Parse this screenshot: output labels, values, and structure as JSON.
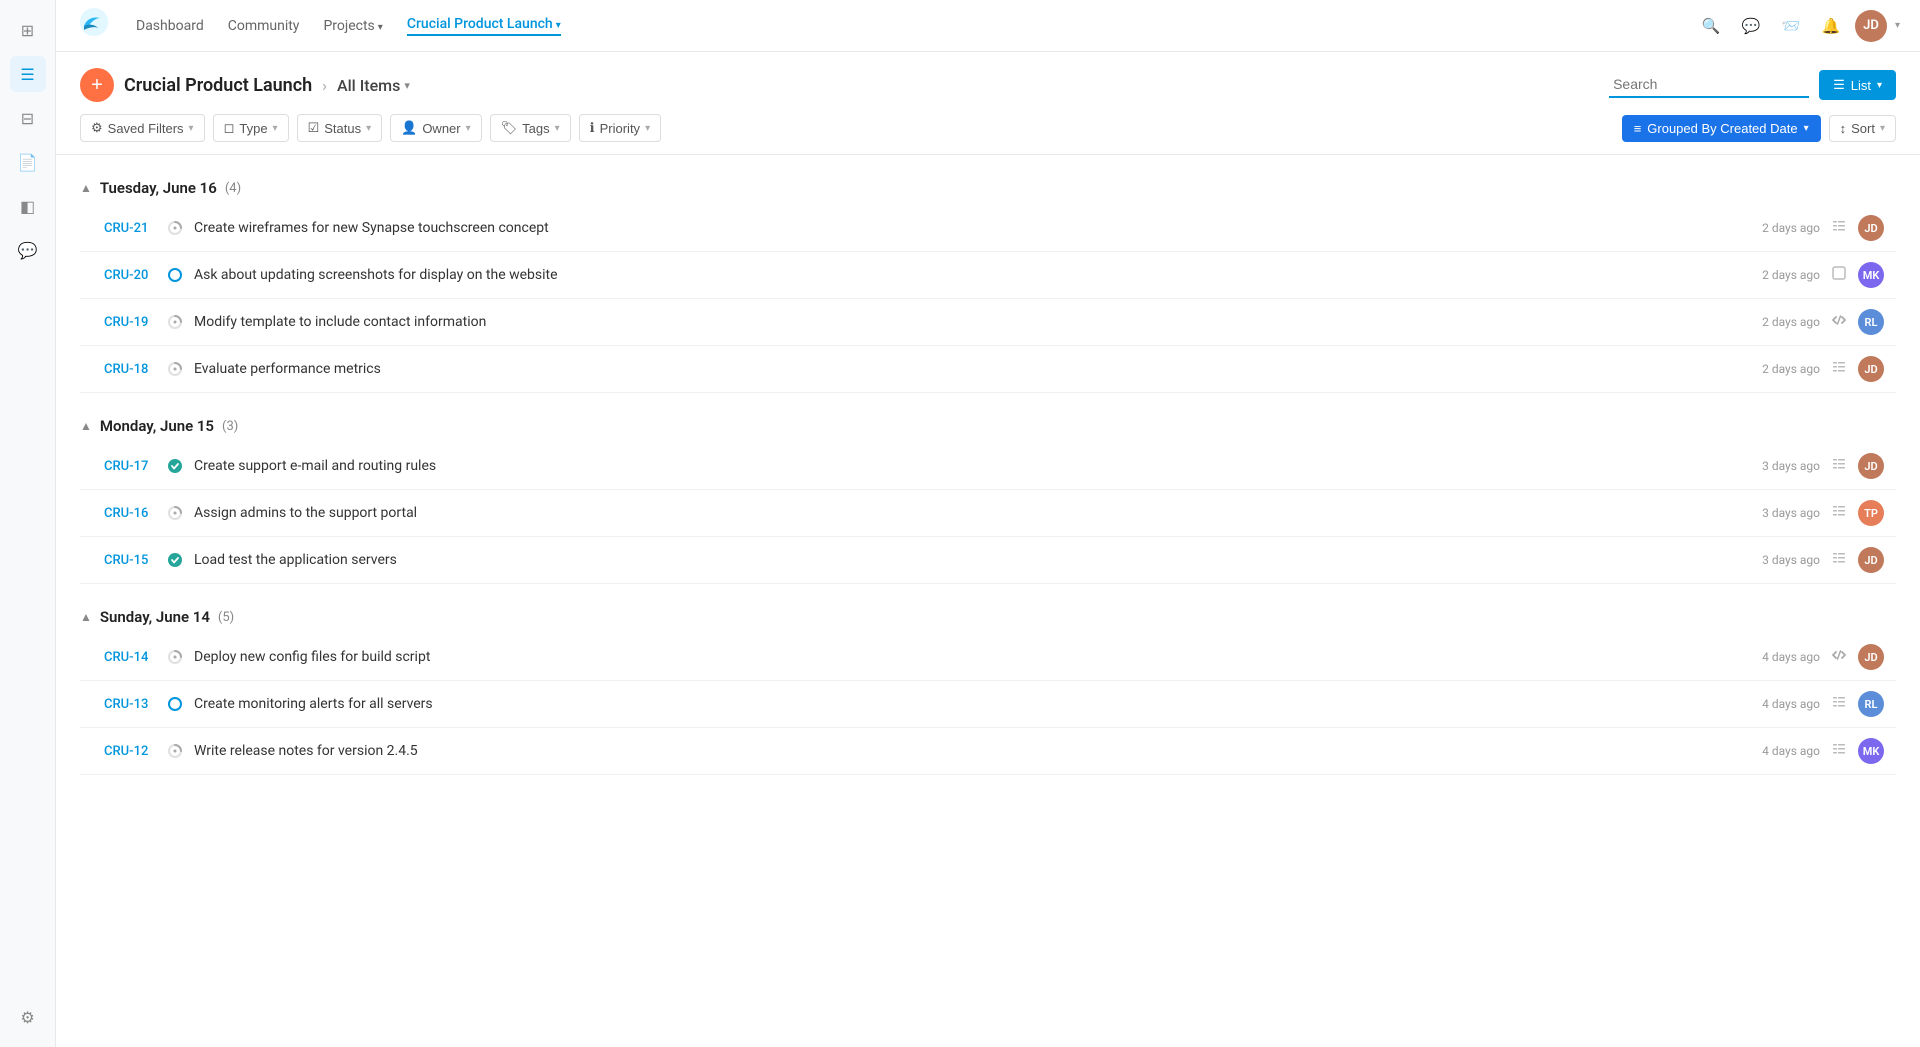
{
  "app": {
    "logo_text": "🐦"
  },
  "nav": {
    "links": [
      {
        "id": "dashboard",
        "label": "Dashboard",
        "active": false
      },
      {
        "id": "community",
        "label": "Community",
        "active": false
      },
      {
        "id": "projects",
        "label": "Projects",
        "has_chevron": true,
        "active": false
      },
      {
        "id": "crucial",
        "label": "Crucial Product Launch",
        "has_chevron": true,
        "active": true
      }
    ]
  },
  "header": {
    "add_btn_label": "+",
    "project_title": "Crucial Product Launch",
    "breadcrumb_sep": "›",
    "all_items_label": "All Items",
    "search_placeholder": "Search",
    "list_view_label": "List"
  },
  "filters": {
    "saved_filters": "Saved Filters",
    "type": "Type",
    "status": "Status",
    "owner": "Owner",
    "tags": "Tags",
    "priority": "Priority",
    "grouped_by": "Grouped By Created Date",
    "sort": "Sort"
  },
  "groups": [
    {
      "id": "tuesday-june-16",
      "title": "Tuesday, June 16",
      "count": 4,
      "tasks": [
        {
          "id": "CRU-21",
          "status": "spinner",
          "title": "Create wireframes for new Synapse touchscreen concept",
          "time": "2 days ago",
          "type_icon": "list",
          "avatar_bg": "#c0795a",
          "avatar_initials": "JD"
        },
        {
          "id": "CRU-20",
          "status": "open",
          "title": "Ask about updating screenshots for display on the website",
          "time": "2 days ago",
          "type_icon": "checkbox",
          "avatar_bg": "#7b68ee",
          "avatar_initials": "MK"
        },
        {
          "id": "CRU-19",
          "status": "spinner",
          "title": "Modify template to include contact information",
          "time": "2 days ago",
          "type_icon": "code",
          "avatar_bg": "#5b8dd9",
          "avatar_initials": "RL"
        },
        {
          "id": "CRU-18",
          "status": "spinner",
          "title": "Evaluate performance metrics",
          "time": "2 days ago",
          "type_icon": "list",
          "avatar_bg": "#c0795a",
          "avatar_initials": "JD"
        }
      ]
    },
    {
      "id": "monday-june-15",
      "title": "Monday, June 15",
      "count": 3,
      "tasks": [
        {
          "id": "CRU-17",
          "status": "done",
          "title": "Create support e-mail and routing rules",
          "time": "3 days ago",
          "type_icon": "list",
          "avatar_bg": "#c0795a",
          "avatar_initials": "JD"
        },
        {
          "id": "CRU-16",
          "status": "spinner",
          "title": "Assign admins to the support portal",
          "time": "3 days ago",
          "type_icon": "list",
          "avatar_bg": "#e67e5a",
          "avatar_initials": "TP"
        },
        {
          "id": "CRU-15",
          "status": "done",
          "title": "Load test the application servers",
          "time": "3 days ago",
          "type_icon": "list",
          "avatar_bg": "#c0795a",
          "avatar_initials": "JD"
        }
      ]
    },
    {
      "id": "sunday-june-14",
      "title": "Sunday, June 14",
      "count": 5,
      "tasks": [
        {
          "id": "CRU-14",
          "status": "spinner",
          "title": "Deploy new config files for build script",
          "time": "4 days ago",
          "type_icon": "code",
          "avatar_bg": "#c0795a",
          "avatar_initials": "JD"
        },
        {
          "id": "CRU-13",
          "status": "open",
          "title": "Create monitoring alerts for all servers",
          "time": "4 days ago",
          "type_icon": "list",
          "avatar_bg": "#5b8dd9",
          "avatar_initials": "RL"
        },
        {
          "id": "CRU-12",
          "status": "spinner",
          "title": "Write release notes for version 2.4.5",
          "time": "4 days ago",
          "type_icon": "list",
          "avatar_bg": "#7b68ee",
          "avatar_initials": "MK"
        }
      ]
    }
  ]
}
